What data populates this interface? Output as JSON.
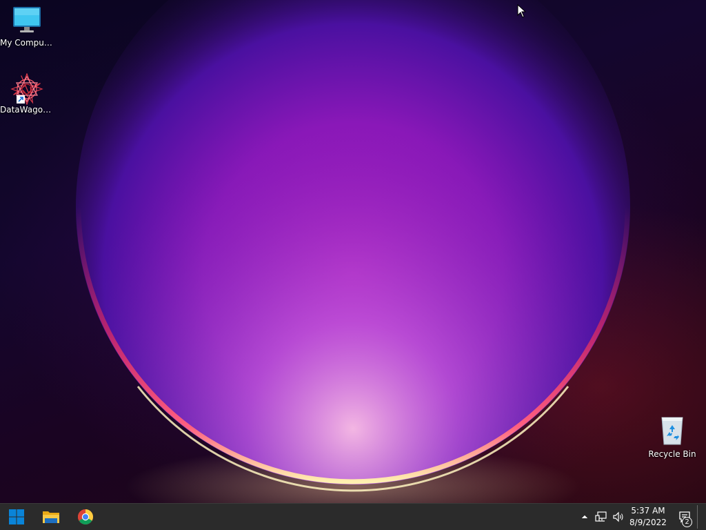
{
  "desktop": {
    "icons": [
      {
        "label": "My Computer",
        "icon": "monitor-icon"
      },
      {
        "label": "DataWagon...",
        "icon": "datawagon-shortcut-icon"
      },
      {
        "label": "Recycle Bin",
        "icon": "recycle-bin-icon"
      }
    ]
  },
  "taskbar": {
    "start_icon": "windows-logo-icon",
    "pinned": [
      {
        "name": "File Explorer",
        "icon": "folder-icon"
      },
      {
        "name": "Google Chrome",
        "icon": "chrome-icon"
      }
    ],
    "tray": {
      "overflow_icon": "chevron-up-icon",
      "network_icon": "network-icon",
      "volume_icon": "speaker-icon"
    },
    "clock": {
      "time": "5:37 AM",
      "date": "8/9/2022"
    },
    "notifications": {
      "icon": "action-center-icon",
      "count": "2"
    }
  },
  "colors": {
    "taskbar_bg": "#2b2b2b",
    "win_blue": "#0a84d8",
    "wallpaper_dark": "#0a0520",
    "orb_magenta": "#b020c0",
    "orb_rim_glow": "#ffd9a0"
  }
}
